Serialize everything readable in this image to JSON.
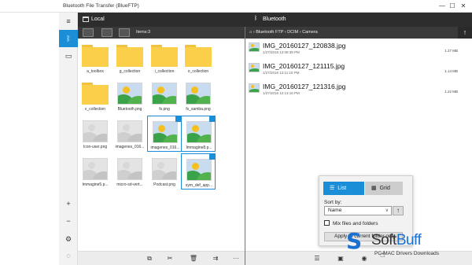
{
  "window": {
    "title": "Bluetooth File Transfer (BlueFTP)",
    "minimize": "—",
    "maximize": "☐",
    "close": "✕"
  },
  "rail": {
    "menu_icon": "hamburger-icon",
    "bt_icon": "bluetooth-icon",
    "local_icon": "folder-icon",
    "add_icon": "plus-icon",
    "remove_icon": "minus-icon",
    "settings_icon": "gear-icon",
    "tip_icon": "lightbulb-icon"
  },
  "local": {
    "label": "Local",
    "items_count": "Items:3"
  },
  "remote": {
    "label": "Bluetooth",
    "breadcrumb": "⌂  ›  Bluetooth FTP  ›  DCIM  ›  Camera"
  },
  "local_items": [
    {
      "name": "a_toolbox",
      "kind": "folder"
    },
    {
      "name": "g_collection",
      "kind": "folder"
    },
    {
      "name": "i_collection",
      "kind": "folder"
    },
    {
      "name": "o_collection",
      "kind": "folder"
    },
    {
      "name": "v_collection",
      "kind": "folder"
    },
    {
      "name": "Bluetooth.png",
      "kind": "image"
    },
    {
      "name": "fs.png",
      "kind": "image"
    },
    {
      "name": "fs_samba.png",
      "kind": "image"
    },
    {
      "name": "Icon-user.png",
      "kind": "gray"
    },
    {
      "name": "imagenes_016...",
      "kind": "gray"
    },
    {
      "name": "imagenes_016...",
      "kind": "image",
      "selected": true
    },
    {
      "name": "Immagine8.p...",
      "kind": "image",
      "selected": true
    },
    {
      "name": "Immagine5.p...",
      "kind": "gray"
    },
    {
      "name": "micro-sd-vert...",
      "kind": "gray"
    },
    {
      "name": "Podcast.png",
      "kind": "gray"
    },
    {
      "name": "sym_def_app...",
      "kind": "image",
      "selected": true
    }
  ],
  "remote_files": [
    {
      "name": "IMG_20160127_120838.jpg",
      "date": "1/27/2016 12:08:38 PM",
      "size": "1.27 MB"
    },
    {
      "name": "IMG_20160127_121115.jpg",
      "date": "1/27/2016 12:11:15 PM",
      "size": "1.14 MB"
    },
    {
      "name": "IMG_20160127_121316.jpg",
      "date": "1/27/2016 12:13:16 PM",
      "size": "1.22 MB"
    }
  ],
  "view_popup": {
    "list_label": "List",
    "grid_label": "Grid",
    "sort_by_label": "Sort by:",
    "sort_value": "Name",
    "mix_label": "Mix files and folders",
    "apply_label": "Apply to current folder only"
  },
  "watermark": {
    "logo": "S",
    "name_a": "Soft",
    "name_b": "Buff",
    "tagline": "PC-MAC Drivers Downloads"
  },
  "colors": {
    "accent": "#1a8fd8",
    "dark_bar": "#2d2d2d",
    "folder": "#fbcf4a"
  }
}
